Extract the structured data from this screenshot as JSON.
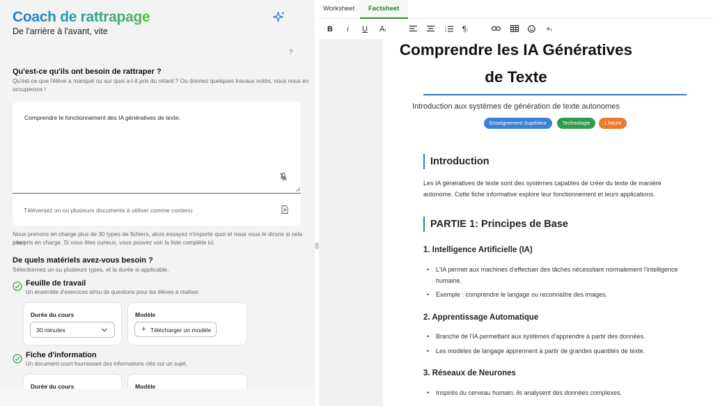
{
  "app": {
    "title": "Coach de rattrapage",
    "subtitle": "De l'arrière à l'avant, vite",
    "help": "?"
  },
  "question1": {
    "title": "Qu'est-ce qu'ils ont besoin de rattraper ?",
    "desc_line1": "Qu'est-ce que l'élève a manqué ou sur quoi a-t-il pris du retard ? Ou donnez quelques travaux notés, nous nous en",
    "desc_line2": "occuperons !",
    "value": "Comprendre le fonctionnement des IA génératives de texte."
  },
  "upload": {
    "label": "Téléversez un ou plusieurs documents à utiliser comme contenu",
    "note_line1": "Nous prenons en charge plus de 30 types de fichiers, alors essayez n'importe quoi et nous vous le dirons si cela n'est",
    "note_line2": "pas pris en charge. Si vous êtes curieux, vous pouvez voir la liste complète ici."
  },
  "question2": {
    "title": "De quels matériels avez-vous besoin ?",
    "desc": "Sélectionnez un ou plusieurs types, et la durée si applicable."
  },
  "materials": [
    {
      "title": "Feuille de travail",
      "desc": "Un ensemble d'exercices et/ou de questions pour les élèves à réaliser.",
      "duration_label": "Durée du cours",
      "duration_value": "30 minutes",
      "model_label": "Modèle",
      "model_button": "Télécharger un modèle"
    },
    {
      "title": "Fiche d'information",
      "desc": "Un document court fournissant des informations clés sur un sujet.",
      "duration_label": "Durée du cours",
      "model_label": "Modèle"
    }
  ],
  "tabs": [
    {
      "label": "Worksheet"
    },
    {
      "label": "Factsheet"
    }
  ],
  "toolbar": {
    "bold": "B",
    "italic": "i",
    "underline": "U",
    "fontsize": "A",
    "paragraph": "¶",
    "insert": "+"
  },
  "doc": {
    "title_line1": "Comprendre les IA Génératives",
    "title_line2": "de Texte",
    "subtitle": "Introduction aux systèmes de génération de texte autonomes",
    "tags": [
      {
        "label": "Enseignement Supérieur",
        "color": "#3b82d6"
      },
      {
        "label": "Technologie",
        "color": "#2e9a4e"
      },
      {
        "label": "1 heure",
        "color": "#ef7b2a"
      }
    ],
    "intro_title": "Introduction",
    "intro_text": "Les IA génératives de texte sont des systèmes capables de créer du texte de manière autonome. Cette fiche informative explore leur fonctionnement et leurs applications.",
    "part1_title": "PARTIE 1: Principes de Base",
    "sections": [
      {
        "title": "1. Intelligence Artificielle (IA)",
        "bullets": [
          "L'IA permet aux machines d'effectuer des tâches nécessitant normalement l'intelligence humaine.",
          "Exemple : comprendre le langage ou reconnaître des images."
        ]
      },
      {
        "title": "2. Apprentissage Automatique",
        "bullets": [
          "Branche de l'IA permettant aux systèmes d'apprendre à partir des données.",
          "Les modèles de langage apprennent à partir de grandes quantités de texte."
        ]
      },
      {
        "title": "3. Réseaux de Neurones",
        "bullets": [
          "Inspirés du cerveau humain, ils analysent des données complexes."
        ]
      }
    ]
  },
  "colors": {
    "accent_green": "#2e7d32",
    "accent_blue": "#3b73c9"
  }
}
